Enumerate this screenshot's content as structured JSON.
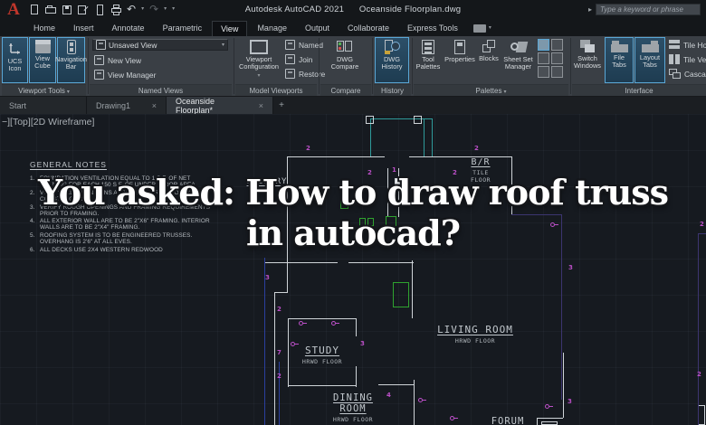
{
  "ui": {
    "caret": "▾",
    "close": "×",
    "plus": "+",
    "search_arrow": "▸",
    "undo": "↶",
    "redo": "↷",
    "logo": "A"
  },
  "title_bar": {
    "app": "Autodesk AutoCAD 2021",
    "doc": "Oceanside Floorplan.dwg",
    "search_placeholder": "Type a keyword or phrase"
  },
  "ribbon": {
    "tabs": [
      {
        "label": "Home"
      },
      {
        "label": "Insert"
      },
      {
        "label": "Annotate"
      },
      {
        "label": "Parametric"
      },
      {
        "label": "View"
      },
      {
        "label": "Manage"
      },
      {
        "label": "Output"
      },
      {
        "label": "Collaborate"
      },
      {
        "label": "Express Tools"
      }
    ],
    "viewport_tools": {
      "label": "Viewport Tools",
      "ucs": "UCS\nIcon",
      "cube": "View\nCube",
      "navbar": "Navigation\nBar"
    },
    "named_views": {
      "label": "Named Views",
      "dropdown": "Unsaved View",
      "new_view": "New View",
      "view_manager": "View Manager"
    },
    "model_viewports": {
      "label": "Model Viewports",
      "config": "Viewport\nConfiguration",
      "named": "Named",
      "join": "Join",
      "restore": "Restore"
    },
    "compare": {
      "label": "Compare",
      "dwg_compare": "DWG\nCompare"
    },
    "history": {
      "label": "History",
      "dwg_history": "DWG\nHistory"
    },
    "palettes": {
      "label": "Palettes",
      "tool_palettes": "Tool\nPalettes",
      "properties": "Properties",
      "blocks": "Blocks",
      "sheet_set": "Sheet Set\nManager"
    },
    "interface": {
      "label": "Interface",
      "switch_windows": "Switch\nWindows",
      "file_tabs": "File\nTabs",
      "layout_tabs": "Layout\nTabs",
      "tile_h": "Tile Horizontally",
      "tile_v": "Tile Vertically",
      "cascade": "Cascade"
    }
  },
  "file_tabs": {
    "start": "Start",
    "drawing1": "Drawing1",
    "active": "Oceanside Floorplan*"
  },
  "canvas": {
    "viewport_label": "−][Top][2D Wireframe]",
    "overlay": {
      "line1": "You asked: How to draw roof truss",
      "line2": "in autocad?"
    },
    "notes": {
      "title": "GENERAL NOTES",
      "items": [
        {
          "n": "1.",
          "t": "FOUNDATION VENTILATION EQUAL TO 1 S.F. OF NET OPENING FOR EACH 150 S.F. OF UNDER FLOOR AREA."
        },
        {
          "n": "2.",
          "t": "VERIFY ALL DIMENSIONS AT JOB SITE PRIOR TO STARTING CONSTRUCTION."
        },
        {
          "n": "3.",
          "t": "VERIFY ROUGH OPENINGS AND FRAMING REQUIREMENTS PRIOR TO FRAMING."
        },
        {
          "n": "4.",
          "t": "ALL EXTERIOR WALL ARE TO BE 2\"X6\" FRAMING. INTERIOR WALLS ARE TO BE 2\"X4\" FRAMING."
        },
        {
          "n": "5.",
          "t": "ROOFING SYSTEM IS TO BE ENGINEERED TRUSSES. OVERHANG IS 2'6\" AT ALL EVES."
        },
        {
          "n": "6.",
          "t": "ALL DECKS USE 2X4 WESTERN REDWOOD"
        }
      ]
    },
    "rooms": {
      "laundry": {
        "name": "LAUNDRY",
        "floor": "TILE"
      },
      "br": {
        "name": "B/R",
        "floor": "TILE FLOOR"
      },
      "living": {
        "name": "LIVING ROOM",
        "floor": "HRWD FLOOR"
      },
      "study": {
        "name": "STUDY",
        "floor": "HRWD FLOOR"
      },
      "dining": {
        "name": "DINING ROOM",
        "floor": "HRWD FLOOR"
      },
      "forum": {
        "name": "FORUM"
      }
    },
    "keynotes": [
      "2",
      "2",
      "1",
      "2",
      "2",
      "2",
      "3",
      "2",
      "7",
      "2",
      "3",
      "3",
      "4",
      "3",
      "2"
    ]
  },
  "colors": {
    "highlight": "#5aa7d6",
    "magenta": "#bb4fc7",
    "teal": "#2f9a9a",
    "green": "#2fa32f",
    "blue": "#2b3f9e",
    "purple": "#3c3570",
    "wall": "#cfd4d8"
  }
}
